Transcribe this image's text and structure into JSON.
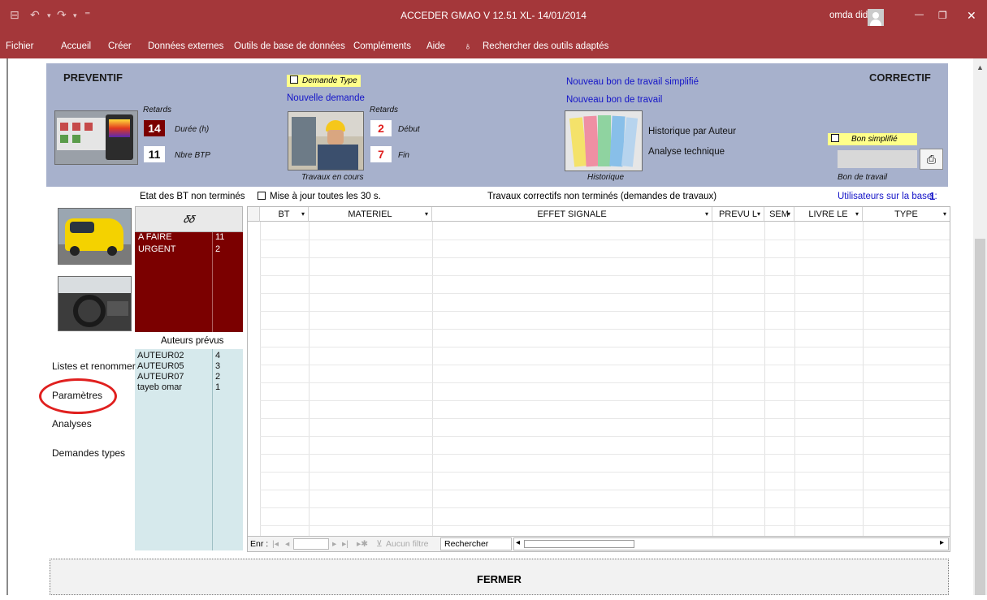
{
  "window": {
    "title": "ACCEDER GMAO V 12.51  XL- 14/01/2014",
    "user": "omda dido",
    "save_glyph": "⊟",
    "undo_glyph": "↶",
    "redo_glyph": "↷",
    "qat_glyph": "⁼",
    "minimize_glyph": "—",
    "restore_glyph": "❐",
    "close_glyph": "✕"
  },
  "menu": {
    "items": [
      "Fichier",
      "Accueil",
      "Créer",
      "Données externes",
      "Outils de base de données",
      "Compléments",
      "Aide"
    ],
    "search_glyph": "♁",
    "search_text": "Rechercher des outils adaptés"
  },
  "colors": {
    "title_bg": "#a4373a",
    "header_panel": "#a7b1cc",
    "list_red": "#7b0000",
    "author_bg": "#d6e9ec",
    "link_blue": "#1414c8",
    "highlight_red": "#e0201f"
  },
  "preventif": {
    "title": "PREVENTIF",
    "retards_label": "Retards",
    "duree_value": "14",
    "duree_label": "Durée (h)",
    "nbre_value": "11",
    "nbre_label": "Nbre BTP"
  },
  "demande": {
    "type_label": "Demande Type",
    "nouvelle_label": "Nouvelle demande",
    "retards_label": "Retards",
    "debut_value": "2",
    "debut_label": "Début",
    "fin_value": "7",
    "fin_label": "Fin",
    "travaux_label": "Travaux en cours"
  },
  "bons": {
    "simplifie_link": "Nouveau bon de travail simplifié",
    "bon_link": "Nouveau bon de travail",
    "historique_auteur": "Historique par Auteur",
    "analyse_technique": "Analyse technique",
    "historique_caption": "Historique"
  },
  "correctif": {
    "title": "CORRECTIF",
    "bon_simplifie_label": "Bon simplifié",
    "bon_travail_label": "Bon de travail",
    "print_glyph": "⎙"
  },
  "etat": {
    "title": "Etat des BT non terminés",
    "glasses_glyph": "𝛿𝛿",
    "rows": [
      {
        "label": "A FAIRE",
        "count": "11"
      },
      {
        "label": "URGENT",
        "count": "2"
      }
    ]
  },
  "auteurs": {
    "title": "Auteurs prévus",
    "rows": [
      {
        "name": "AUTEUR02",
        "count": "4"
      },
      {
        "name": "AUTEUR05",
        "count": "3"
      },
      {
        "name": "AUTEUR07",
        "count": "2"
      },
      {
        "name": "tayeb omar",
        "count": "1"
      }
    ]
  },
  "left_links": {
    "listes": "Listes et renommer",
    "parametres": "Paramètres",
    "analyses": "Analyses",
    "demandes_types": "Demandes types"
  },
  "mise_a_jour": "Mise à jour toutes les 30 s.",
  "grid": {
    "title": "Travaux correctifs non terminés (demandes de travaux)",
    "users_label": "Utilisateurs sur la base :",
    "users_count": "1",
    "dropdown_glyph": "▾",
    "columns": [
      "BT",
      "MATERIEL",
      "EFFET SIGNALE",
      "PREVU L",
      "SEM",
      "LIVRE LE",
      "TYPE"
    ],
    "nav": {
      "enr_label": "Enr :",
      "first": "|◂",
      "prev": "◂",
      "next": "▸",
      "last": "▸|",
      "new": "▸✱",
      "filter_glyph": "⊻",
      "filter": "Aucun filtre",
      "search": "Rechercher",
      "scroll_left": "◂",
      "scroll_right": "▸"
    }
  },
  "fermer": "FERMER"
}
